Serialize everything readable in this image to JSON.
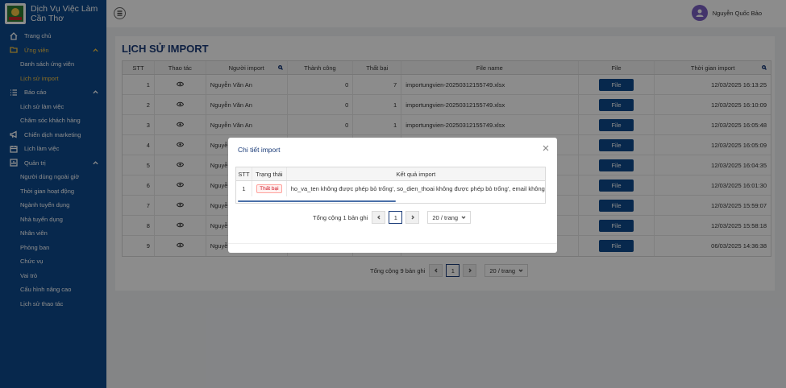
{
  "brand": {
    "line1": "Dịch Vụ Việc Làm",
    "line2": "Cần Thơ"
  },
  "header": {
    "user_name": "Nguyễn Quốc Bảo"
  },
  "sidebar": {
    "home": "Trang chủ",
    "candidates": "Ứng viên",
    "candidate_list": "Danh sách ứng viên",
    "import_history": "Lịch sử import",
    "reports": "Báo cáo",
    "work_history": "Lịch sử làm việc",
    "customer_care": "Chăm sóc khách hàng",
    "marketing": "Chiến dịch marketing",
    "work_schedule": "Lịch làm việc",
    "admin": "Quản trị",
    "external_users": "Người dùng ngoài giờ",
    "working_hours": "Thời gian hoạt động",
    "recruit_sectors": "Ngành tuyển dụng",
    "recruiters": "Nhà tuyển dụng",
    "staff": "Nhân viên",
    "departments": "Phòng ban",
    "positions": "Chức vụ",
    "roles": "Vai trò",
    "advanced_config": "Cấu hình nâng cao",
    "action_history": "Lịch sử thao tác"
  },
  "page": {
    "title": "LỊCH SỬ IMPORT"
  },
  "table": {
    "headers": [
      "STT",
      "Thao tác",
      "Người import",
      "Thành công",
      "Thất bại",
      "File name",
      "File",
      "Thời gian import"
    ],
    "file_button": "File",
    "rows": [
      {
        "stt": "1",
        "user": "Nguyễn Văn An",
        "success": "0",
        "fail": "7",
        "filename": "importungvien-20250312155749.xlsx",
        "time": "12/03/2025 16:13:25"
      },
      {
        "stt": "2",
        "user": "Nguyễn Văn An",
        "success": "0",
        "fail": "1",
        "filename": "importungvien-20250312155749.xlsx",
        "time": "12/03/2025 16:10:09"
      },
      {
        "stt": "3",
        "user": "Nguyễn Văn An",
        "success": "0",
        "fail": "1",
        "filename": "importungvien-20250312155749.xlsx",
        "time": "12/03/2025 16:05:48"
      },
      {
        "stt": "4",
        "user": "Nguyễ",
        "success": "",
        "fail": "",
        "filename": "",
        "time": "12/03/2025 16:05:09"
      },
      {
        "stt": "5",
        "user": "Nguyễ",
        "success": "",
        "fail": "",
        "filename": "",
        "time": "12/03/2025 16:04:35"
      },
      {
        "stt": "6",
        "user": "Nguyễ",
        "success": "",
        "fail": "",
        "filename": "",
        "time": "12/03/2025 16:01:30"
      },
      {
        "stt": "7",
        "user": "Nguyễ",
        "success": "",
        "fail": "",
        "filename": "",
        "time": "12/03/2025 15:59:07"
      },
      {
        "stt": "8",
        "user": "Nguyễ",
        "success": "",
        "fail": "",
        "filename": "",
        "time": "12/03/2025 15:58:18"
      },
      {
        "stt": "9",
        "user": "Nguyễ",
        "success": "",
        "fail": "",
        "filename": "",
        "time": "06/03/2025 14:36:38"
      }
    ]
  },
  "pager": {
    "total": "Tổng cộng 9 bản ghi",
    "page": "1",
    "per_page": "20 / trang"
  },
  "modal": {
    "title": "Chi tiết import",
    "headers": [
      "STT",
      "Trạng thái",
      "Kết quả import"
    ],
    "rows": [
      {
        "stt": "1",
        "status": "Thất bại",
        "result": "ho_va_ten không được phép bỏ trống', so_dien_thoai không được phép bỏ trống', email không được"
      }
    ],
    "pager": {
      "total": "Tổng cộng 1 bản ghi",
      "page": "1",
      "per_page": "20 / trang"
    }
  }
}
